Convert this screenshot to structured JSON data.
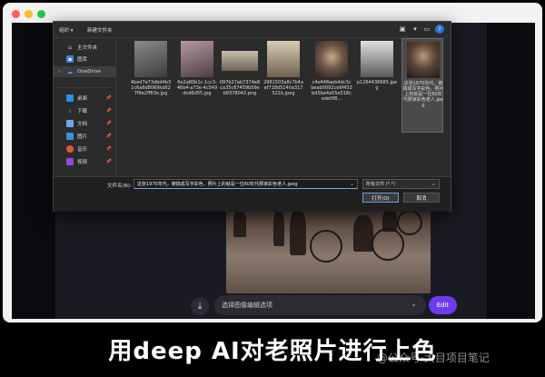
{
  "window": {
    "controls": [
      "close",
      "minimize",
      "maximize"
    ]
  },
  "dialog": {
    "toolbar": {
      "organize_label": "组织 ▾",
      "new_folder_label": "新建文件夹"
    },
    "nav": [
      {
        "label": "主文件夹",
        "icon": "home-icon"
      },
      {
        "label": "图库",
        "icon": "gallery-icon"
      },
      {
        "label": "OneDrive",
        "icon": "cloud-icon",
        "active": true
      },
      {
        "label": "桌面",
        "icon": "desktop-icon"
      },
      {
        "label": "下载",
        "icon": "download-icon"
      },
      {
        "label": "文档",
        "icon": "document-icon"
      },
      {
        "label": "图片",
        "icon": "pictures-icon"
      },
      {
        "label": "音乐",
        "icon": "music-icon"
      },
      {
        "label": "视频",
        "icon": "video-icon"
      }
    ],
    "files": [
      {
        "name": "4bed7e73dbd4b31c6a6d8069kd627f8e2ff83e.jpg",
        "tone": "#5a5a5a"
      },
      {
        "name": "6e2a80b1c-1cc3-46b4-a73e-4c549dcd6d55.jpg",
        "tone": "#7a6a70"
      },
      {
        "name": "097b27ab7374e8ca35c67459b59eb8378042.png",
        "tone": "#8a8070"
      },
      {
        "name": "2981503a8c7b4aef718d5240a317521b.jpeg",
        "tone": "#9a8a78"
      },
      {
        "name": "c4e448aeb4dc3cbeab0092ce9f433bd5be4a55e518cede0f8...",
        "tone": "#8a7a6a"
      },
      {
        "name": "p1264436685.jpeg",
        "tone": "#9c9c9c"
      },
      {
        "name": "这张1970年代，被搞成写字彩色，照片上的就是一位60年代那家彩色老人.jpeg",
        "tone": "#6b5b50",
        "selected": true
      }
    ],
    "filename_label": "文件名(N):",
    "filename_value": "这张1970年代，被搞成写字彩色，照片上的就是一位60年代那家彩色老人.jpeg",
    "filetype_value": "所有文件 (*.*)",
    "open_label": "打开(O)",
    "cancel_label": "取消"
  },
  "app": {
    "select_placeholder": "选择图像编辑选项",
    "edit_label": "Edit"
  },
  "caption": "用deep AI对老照片进行上色",
  "watermark": "@公众号·大目项目笔记"
}
